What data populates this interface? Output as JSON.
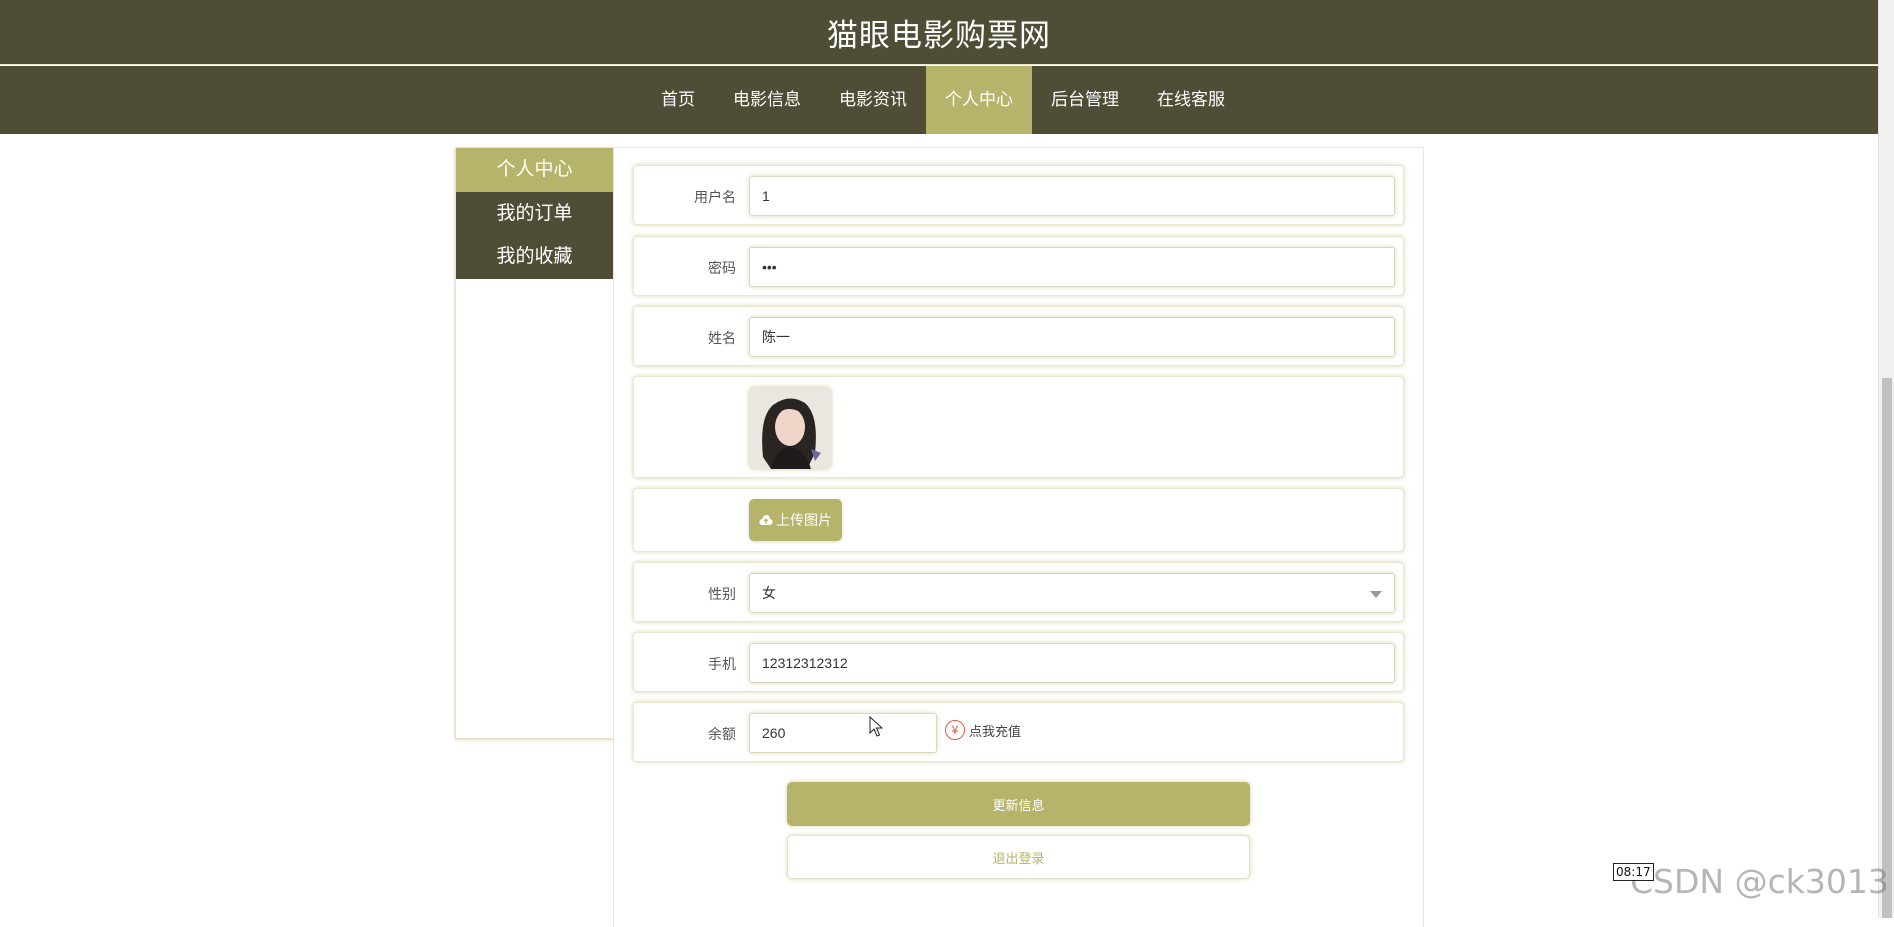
{
  "site": {
    "title": "猫眼电影购票网"
  },
  "nav": {
    "items": [
      {
        "label": "首页",
        "active": false
      },
      {
        "label": "电影信息",
        "active": false
      },
      {
        "label": "电影资讯",
        "active": false
      },
      {
        "label": "个人中心",
        "active": true
      },
      {
        "label": "后台管理",
        "active": false
      },
      {
        "label": "在线客服",
        "active": false
      }
    ]
  },
  "sidebar": {
    "items": [
      {
        "label": "个人中心",
        "active": true
      },
      {
        "label": "我的订单",
        "active": false
      },
      {
        "label": "我的收藏",
        "active": false
      }
    ]
  },
  "form": {
    "username": {
      "label": "用户名",
      "value": "1"
    },
    "password": {
      "label": "密码",
      "value": "•••"
    },
    "name": {
      "label": "姓名",
      "value": "陈一"
    },
    "upload_label": "上传图片",
    "gender": {
      "label": "性别",
      "value": "女"
    },
    "phone": {
      "label": "手机",
      "value": "12312312312"
    },
    "balance": {
      "label": "余额",
      "value": "260",
      "recharge_label": "点我充值",
      "currency_symbol": "¥"
    }
  },
  "actions": {
    "update_label": "更新信息",
    "logout_label": "退出登录"
  },
  "overlay": {
    "time": "08:17",
    "watermark": "CSDN @ck3013"
  },
  "colors": {
    "header_bg": "#4f4d35",
    "accent": "#b6b46a",
    "recharge_icon": "#e25a4a"
  }
}
